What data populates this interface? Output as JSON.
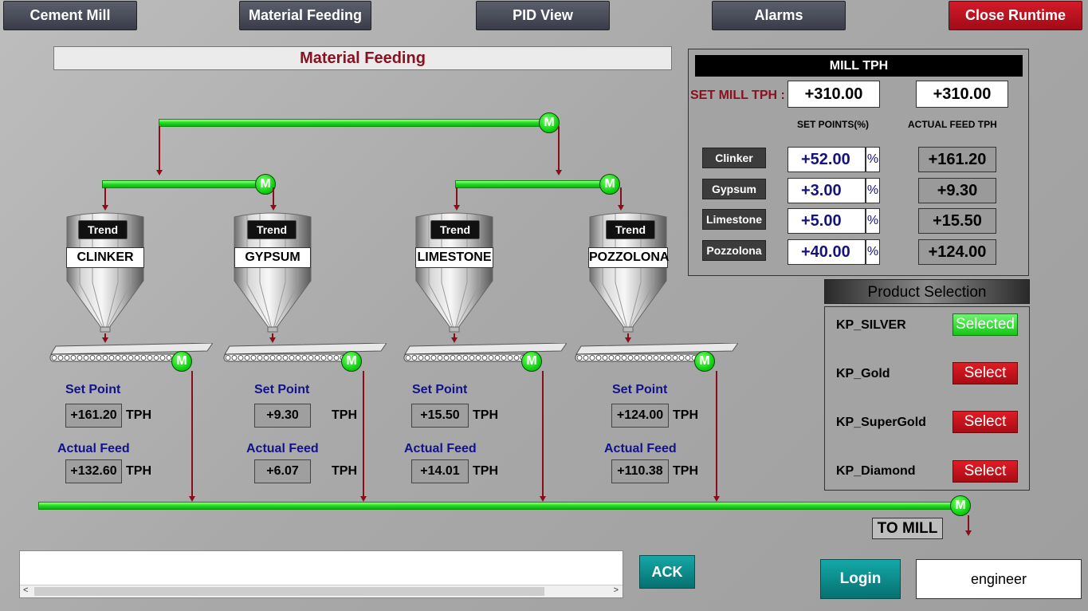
{
  "nav": {
    "cement_mill": "Cement Mill",
    "material_feeding": "Material Feeding",
    "pid_view": "PID View",
    "alarms": "Alarms",
    "close_runtime": "Close Runtime"
  },
  "page_title": "Material Feeding",
  "motor_label": "M",
  "hoppers": [
    {
      "name": "CLINKER",
      "trend": "Trend",
      "set_point_label": "Set Point",
      "set_point": "+161.20",
      "actual_label": "Actual Feed",
      "actual": "+132.60",
      "unit": "TPH"
    },
    {
      "name": "GYPSUM",
      "trend": "Trend",
      "set_point_label": "Set Point",
      "set_point": "+9.30",
      "actual_label": "Actual Feed",
      "actual": "+6.07",
      "unit": "TPH"
    },
    {
      "name": "LIMESTONE",
      "trend": "Trend",
      "set_point_label": "Set Point",
      "set_point": "+15.50",
      "actual_label": "Actual Feed",
      "actual": "+14.01",
      "unit": "TPH"
    },
    {
      "name": "POZZOLONA",
      "trend": "Trend",
      "set_point_label": "Set Point",
      "set_point": "+124.00",
      "actual_label": "Actual Feed",
      "actual": "+110.38",
      "unit": "TPH"
    }
  ],
  "to_mill": "TO MILL",
  "mill_tph": {
    "header": "MILL TPH",
    "set_label": "SET MILL TPH :",
    "set_value": "+310.00",
    "actual_value": "+310.00",
    "col_set_points": "SET POINTS(%)",
    "col_actual": "ACTUAL FEED TPH",
    "pct_symbol": "%",
    "rows": [
      {
        "material": "Clinker",
        "set_pct": "+52.00",
        "actual": "+161.20"
      },
      {
        "material": "Gypsum",
        "set_pct": "+3.00",
        "actual": "+9.30"
      },
      {
        "material": "Limestone",
        "set_pct": "+5.00",
        "actual": "+15.50"
      },
      {
        "material": "Pozzolona",
        "set_pct": "+40.00",
        "actual": "+124.00"
      }
    ]
  },
  "product_selection": {
    "header": "Product Selection",
    "items": [
      {
        "name": "KP_SILVER",
        "button": "Selected",
        "state": "selected"
      },
      {
        "name": "KP_Gold",
        "button": "Select",
        "state": "unselected"
      },
      {
        "name": "KP_SuperGold",
        "button": "Select",
        "state": "unselected"
      },
      {
        "name": "KP_Diamond",
        "button": "Select",
        "state": "unselected"
      }
    ]
  },
  "bottom": {
    "ack": "ACK",
    "login": "Login",
    "user": "engineer",
    "scroll_left": "<",
    "scroll_right": ">"
  },
  "colors": {
    "motor_green": "#12d412",
    "line_red": "#8b0d1a",
    "title_red": "#8b1020",
    "label_blue": "#12128a",
    "teal": "#0d8c8c"
  }
}
